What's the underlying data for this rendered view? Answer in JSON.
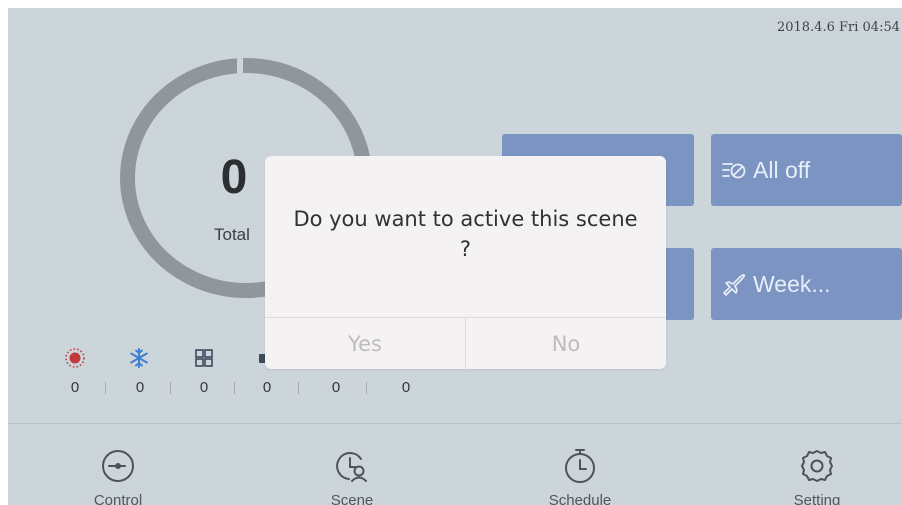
{
  "status_bar": {
    "datetime": "2018.4.6 Fri 04:54"
  },
  "summary": {
    "total_count": "0",
    "total_label": "Total"
  },
  "stats": [
    {
      "icon": "heat-icon",
      "value": "0",
      "color": "#c23a3e"
    },
    {
      "icon": "snowflake-icon",
      "value": "0",
      "color": "#3f7fd2"
    },
    {
      "icon": "grid-icon",
      "value": "0",
      "color": "#3d4a5c"
    },
    {
      "icon": "device-icon",
      "value": "0",
      "color": "#3d4a5c"
    },
    {
      "icon": "stat-5-icon",
      "value": "0",
      "color": "#3d4a5c"
    },
    {
      "icon": "stat-6-icon",
      "value": "0",
      "color": "#3d4a5c"
    }
  ],
  "tiles": [
    {
      "icon": "all-off-icon",
      "label": "All off"
    },
    {
      "icon": "plane-icon",
      "label": "Week..."
    }
  ],
  "nav": [
    {
      "icon": "control-icon",
      "label": "Control"
    },
    {
      "icon": "scene-icon",
      "label": "Scene"
    },
    {
      "icon": "schedule-icon",
      "label": "Schedule"
    },
    {
      "icon": "setting-icon",
      "label": "Setting"
    }
  ],
  "dialog": {
    "message": "Do you want to active this scene ?",
    "yes_label": "Yes",
    "no_label": "No"
  },
  "colors": {
    "background": "#ccd5da",
    "tile": "#7b94c2",
    "ring": "#90979b",
    "dialog": "#f5f2f4"
  }
}
